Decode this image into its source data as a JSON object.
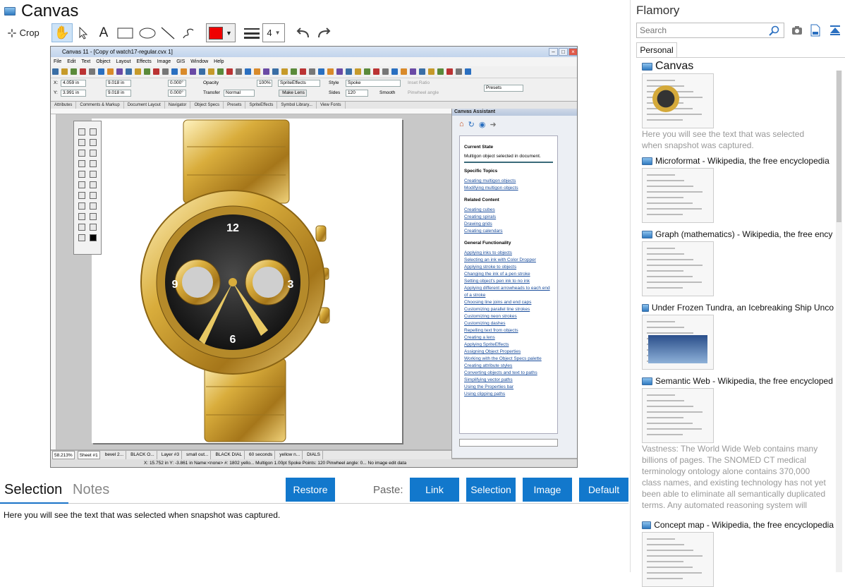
{
  "left": {
    "title": "Canvas",
    "toolbar": {
      "crop_label": "Crop",
      "text_tool_glyph": "A",
      "line_width_value": "4",
      "fill_color": "#ee0000"
    },
    "snapshot": {
      "window_title": "Canvas 11 - [Copy of watch17-regular.cvx  1]",
      "menu": [
        "File",
        "Edit",
        "Text",
        "Object",
        "Layout",
        "Effects",
        "Image",
        "GIS",
        "Window",
        "Help"
      ],
      "props": {
        "x_label": "X:",
        "x_value": "4.059 in",
        "y_label": "Y:",
        "y_value": "3.991 in",
        "w_value": "9.018 in",
        "h_value": "9.018 in",
        "angle1": "0.000°",
        "angle2": "0.000°",
        "opacity_label": "Opacity",
        "opacity_value": "100%",
        "transfer_label": "Transfer",
        "transfer_value": "Normal",
        "sprite_value": "SpriteEffects",
        "make_lens": "Make Lens",
        "style_label": "Style",
        "style_value": "Spoke",
        "sides_label": "Sides",
        "sides_value": "120",
        "smooth_label": "Smooth",
        "inset_label": "Inset Ratio",
        "pinwheel_label": "Pinwheel angle",
        "presets_value": "Presets"
      },
      "tabs": [
        "Attributes",
        "Comments & Markup",
        "Document Layout",
        "Navigator",
        "Object Specs",
        "Presets",
        "SpriteEffects",
        "Symbol Library...",
        "View Fonts"
      ],
      "assistant": {
        "title": "Canvas Assistant",
        "current_state_heading": "Current State",
        "current_state_text": "Multigon object selected in document.",
        "specific_heading": "Specific Topics",
        "specific_links": [
          "Creating multigon objects",
          "Modifying multigon objects"
        ],
        "related_heading": "Related Content",
        "related_links": [
          "Creating cubes",
          "Creating spirals",
          "Drawing grids",
          "Creating calendars"
        ],
        "general_heading": "General Functionality",
        "general_links": [
          "Applying inks to objects",
          "Selecting an ink with Color Dropper",
          "Applying stroke to objects",
          "Changing the ink of a pen stroke",
          "Setting object's pen ink to no ink",
          "Applying different arrowheads to each end of a stroke",
          "Choosing line joins and end caps",
          "Customizing parallel line strokes",
          "Customizing neon strokes",
          "Customizing dashes",
          "Repelling text from objects",
          "Creating a lens",
          "Applying SpriteEffects",
          "Assigning Object Properties",
          "Working with the Object Specs palette",
          "Creating attribute styles",
          "Converting objects and text to paths",
          "Simplifying vector paths",
          "Using the Properties bar",
          "Using clipping paths"
        ]
      },
      "status_zoom": "58.213%",
      "status_sheet": "Sheet #1",
      "status_layers": [
        "bevel 2...",
        "BLACK O...",
        "Layer #3",
        "small out...",
        "BLACK DIAL",
        "60 seconds",
        "yellow n...",
        "DIALS"
      ],
      "status_line2": "X: 15.752 in  Y: -3.861 in    Name:<none>    #: 1802  yello...    Multigon    1.00pt    Spoke  Points: 120  Pinwheel angle: 0...   No image edit data",
      "watch_numbers": [
        "12",
        "9",
        "3",
        "6"
      ]
    },
    "tabs": {
      "selection": "Selection",
      "notes": "Notes"
    },
    "buttons": {
      "restore": "Restore",
      "paste_label": "Paste:",
      "link": "Link",
      "selection": "Selection",
      "image": "Image",
      "default": "Default"
    },
    "selection_text": "Here you will see the text that was selected when snapshot was captured."
  },
  "right": {
    "title": "Flamory",
    "search_placeholder": "Search",
    "tab_personal": "Personal",
    "history": [
      {
        "title": "Canvas",
        "desc": "Here you will see the text that was selected when snapshot was captured."
      },
      {
        "title": "Microformat - Wikipedia, the free encyclopedia",
        "desc": ""
      },
      {
        "title": "Graph (mathematics) - Wikipedia, the free ency",
        "desc": ""
      },
      {
        "title": "Under Frozen Tundra, an Icebreaking Ship Unco",
        "desc": ""
      },
      {
        "title": "Semantic Web - Wikipedia, the free encycloped",
        "desc": "Vastness: The World Wide Web contains many billions of pages. The SNOMED CT medical terminology ontology alone contains 370,000 class names, and existing technology has not yet been able to eliminate all semantically duplicated terms. Any automated reasoning system will have to deal with truly huge inputs."
      },
      {
        "title": "Concept map - Wikipedia, the free encyclopedia",
        "desc": ""
      }
    ]
  },
  "colors": {
    "accent": "#1278cc",
    "gold": "#d4a93a"
  }
}
